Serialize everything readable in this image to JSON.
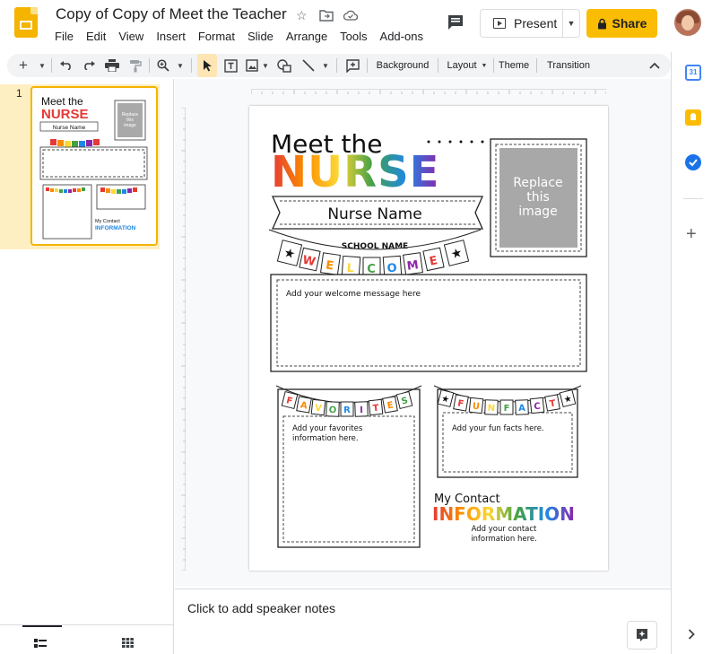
{
  "header": {
    "title": "Copy of Copy of Meet the Teacher",
    "menus": [
      "File",
      "Edit",
      "View",
      "Insert",
      "Format",
      "Slide",
      "Arrange",
      "Tools",
      "Add-ons"
    ],
    "present_label": "Present",
    "share_label": "Share"
  },
  "toolbar": {
    "background_label": "Background",
    "layout_label": "Layout",
    "theme_label": "Theme",
    "transition_label": "Transition"
  },
  "filmstrip": {
    "slide_number": "1"
  },
  "slide": {
    "heading_line1": "Meet the",
    "heading_line2": "NURSE",
    "name_banner": "Nurse Name",
    "school_name": "SCHOOL NAME",
    "welcome_letters": [
      "W",
      "E",
      "L",
      "C",
      "O",
      "M",
      "E"
    ],
    "welcome_message": "Add your welcome message here",
    "image_placeholder_lines": [
      "Replace",
      "this",
      "image"
    ],
    "favorites_letters": [
      "F",
      "A",
      "V",
      "O",
      "R",
      "I",
      "T",
      "E",
      "S"
    ],
    "favorites_text_lines": [
      "Add your favorites",
      "information here."
    ],
    "funfact_letters": [
      "F",
      "U",
      "N",
      "F",
      "A",
      "C",
      "T"
    ],
    "funfact_text": "Add your fun facts here.",
    "contact_line1": "My Contact",
    "contact_line2": "INFORMATION",
    "contact_text_lines": [
      "Add your contact",
      "information here."
    ]
  },
  "thumbnail": {
    "heading_line1": "Meet the",
    "heading_line2": "NURSE",
    "name_banner": "Nurse Name",
    "image_lines": [
      "Replace",
      "this",
      "image"
    ],
    "contact_line1": "My Contact",
    "contact_line2": "INFORMATION"
  },
  "notes": {
    "placeholder": "Click to add speaker notes"
  },
  "colors": {
    "share": "#fbbc04",
    "thumb_highlight": "#feefc3",
    "rainbow": [
      "#e53935",
      "#fb8c00",
      "#fdd835",
      "#43a047",
      "#1e88e5",
      "#8e24aa"
    ]
  }
}
